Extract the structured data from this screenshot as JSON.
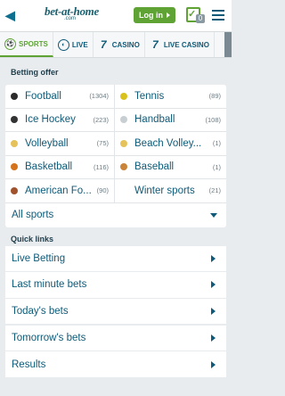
{
  "header": {
    "logo_main": "bet-at-home",
    "logo_sub": ".com",
    "login_label": "Log in",
    "betslip_count": "0"
  },
  "nav": [
    {
      "label": "SPORTS",
      "icon": "soccer-ball-icon",
      "glyph": "⚽",
      "active": true
    },
    {
      "label": "LIVE",
      "icon": "live-ball-icon",
      "glyph": "◐",
      "active": false
    },
    {
      "label": "CASINO",
      "icon": "casino-seven-icon",
      "glyph": "7",
      "active": false
    },
    {
      "label": "LIVE CASINO",
      "icon": "live-casino-seven-icon",
      "glyph": "7",
      "active": false
    }
  ],
  "betting_offer": {
    "title": "Betting offer",
    "sports": [
      {
        "name": "Football",
        "count": "(1304)",
        "icon": "football-icon",
        "color": "#2b2b2b"
      },
      {
        "name": "Tennis",
        "count": "(89)",
        "icon": "tennis-ball-icon",
        "color": "#d9c21e"
      },
      {
        "name": "Ice Hockey",
        "count": "(223)",
        "icon": "ice-hockey-puck-icon",
        "color": "#333333"
      },
      {
        "name": "Handball",
        "count": "(108)",
        "icon": "handball-icon",
        "color": "#c8cfd3"
      },
      {
        "name": "Volleyball",
        "count": "(75)",
        "icon": "volleyball-icon",
        "color": "#e6c25a"
      },
      {
        "name": "Beach Volley...",
        "count": "(1)",
        "icon": "beach-volleyball-icon",
        "color": "#e6c25a"
      },
      {
        "name": "Basketball",
        "count": "(116)",
        "icon": "basketball-icon",
        "color": "#d4731c"
      },
      {
        "name": "Baseball",
        "count": "(1)",
        "icon": "baseball-icon",
        "color": "#c9843a"
      },
      {
        "name": "American Fo...",
        "count": "(90)",
        "icon": "american-football-icon",
        "color": "#a0522d"
      },
      {
        "name": "Winter sports",
        "count": "(21)",
        "icon": "winter-sports-icon",
        "color": "#ffffff"
      }
    ],
    "all_sports_label": "All sports"
  },
  "quick_links": {
    "title": "Quick links",
    "items": [
      "Live Betting",
      "Last minute bets",
      "Today's bets",
      "Tomorrow's bets",
      "Results"
    ]
  }
}
